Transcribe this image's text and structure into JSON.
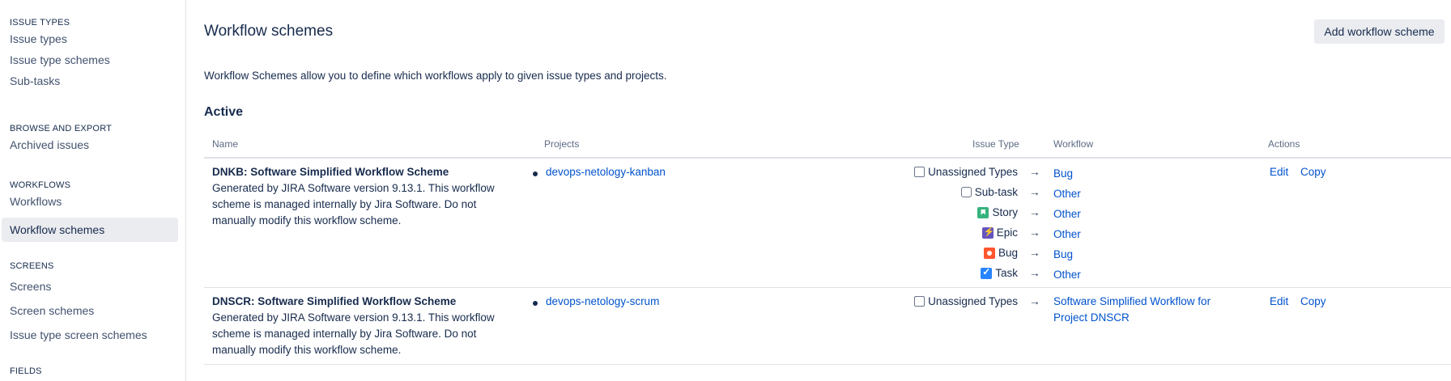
{
  "sidebar": {
    "sections": [
      {
        "heading": "ISSUE TYPES",
        "items": [
          "Issue types",
          "Issue type schemes",
          "Sub-tasks"
        ]
      },
      {
        "heading": "BROWSE AND EXPORT",
        "items": [
          "Archived issues"
        ]
      },
      {
        "heading": "WORKFLOWS",
        "items": [
          "Workflows",
          "Workflow schemes"
        ]
      },
      {
        "heading": "SCREENS",
        "items": [
          "Screens",
          "Screen schemes",
          "Issue type screen schemes"
        ]
      },
      {
        "heading": "FIELDS",
        "items": []
      }
    ],
    "active_item": "Workflow schemes"
  },
  "page": {
    "title": "Workflow schemes",
    "add_button": "Add workflow scheme",
    "description": "Workflow Schemes allow you to define which workflows apply to given issue types and projects.",
    "section_title": "Active"
  },
  "table": {
    "headers": {
      "name": "Name",
      "projects": "Projects",
      "issue_type": "Issue Type",
      "workflow": "Workflow",
      "actions": "Actions"
    },
    "rows": [
      {
        "name": "DNKB: Software Simplified Workflow Scheme",
        "description_lines": [
          "Generated by JIRA Software version 9.13.1. This workflow",
          "scheme is managed internally by Jira Software. Do not",
          "manually modify this workflow scheme."
        ],
        "project": "devops-netology-kanban",
        "mappings": [
          {
            "issue_type": "Unassigned Types",
            "icon": "unassigned-icon",
            "workflow": "Bug"
          },
          {
            "issue_type": "Sub-task",
            "icon": "subtask-icon",
            "workflow": "Other"
          },
          {
            "issue_type": "Story",
            "icon": "story-icon",
            "workflow": "Other"
          },
          {
            "issue_type": "Epic",
            "icon": "epic-icon",
            "workflow": "Other"
          },
          {
            "issue_type": "Bug",
            "icon": "bug-icon",
            "workflow": "Bug"
          },
          {
            "issue_type": "Task",
            "icon": "task-icon",
            "workflow": "Other"
          }
        ],
        "actions": [
          "Edit",
          "Copy"
        ]
      },
      {
        "name": "DNSCR: Software Simplified Workflow Scheme",
        "description_lines": [
          "Generated by JIRA Software version 9.13.1. This workflow",
          "scheme is managed internally by Jira Software. Do not",
          "manually modify this workflow scheme."
        ],
        "project": "devops-netology-scrum",
        "mappings": [
          {
            "issue_type": "Unassigned Types",
            "icon": "unassigned-icon",
            "workflow_lines": [
              "Software Simplified Workflow for",
              "Project DNSCR"
            ]
          }
        ],
        "actions": [
          "Edit",
          "Copy"
        ]
      }
    ],
    "arrow": "→"
  },
  "colors": {
    "link": "#0052cc",
    "text": "#172b4d",
    "active_bg": "#ebecf0",
    "border": "#dfe1e6"
  }
}
